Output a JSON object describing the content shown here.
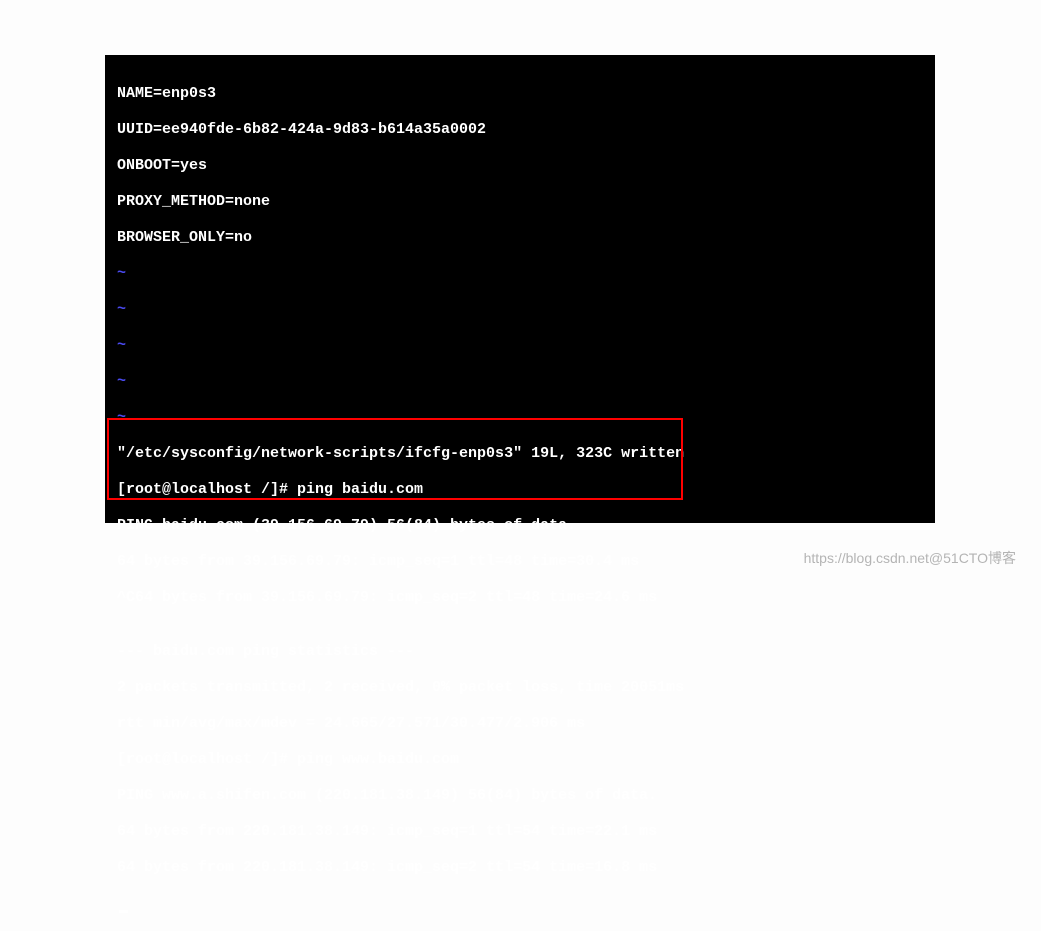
{
  "config": {
    "name": "NAME=enp0s3",
    "uuid": "UUID=ee940fde-6b82-424a-9d83-b614a35a0002",
    "onboot": "ONBOOT=yes",
    "proxy": "PROXY_METHOD=none",
    "browser": "BROWSER_ONLY=no"
  },
  "tilde": "~",
  "saved": "\"/etc/sysconfig/network-scripts/ifcfg-enp0s3\" 19L, 323C written",
  "prompt1": "[root@localhost /]# ping baidu.com",
  "ping1_header": "PING baidu.com (39.156.69.79) 56(84) bytes of data.",
  "ping1_l1": "64 bytes from 39.156.69.79: icmp_seq=1 ttl=48 time=30.4 ms",
  "ping1_l2": "^C64 bytes from 39.156.69.79: icmp_seq=2 ttl=48 time=24.6 ms",
  "blank": "",
  "stats_hdr": "--- baidu.com ping statistics ---",
  "stats_l1": "2 packets transmitted, 2 received, 0% packet loss, time 20051ms",
  "stats_l2": "rtt min/avg/max/mdev = 24.665/27.571/30.477/2.906 ms",
  "prompt2": "[root@localhost /]# ping www.baidu.com",
  "ping2_header": "PING www.a.shifen.com (220.181.38.149) 56(84) bytes of data.",
  "ping2_l1": "64 bytes from 220.181.38.149: icmp_seq=1 ttl=54 time=22.1 ms",
  "ping2_l2": "64 bytes from 220.181.38.149: icmp_seq=2 ttl=54 time=16.8 ms",
  "watermark": "https://blog.csdn.net@51CTO博客"
}
